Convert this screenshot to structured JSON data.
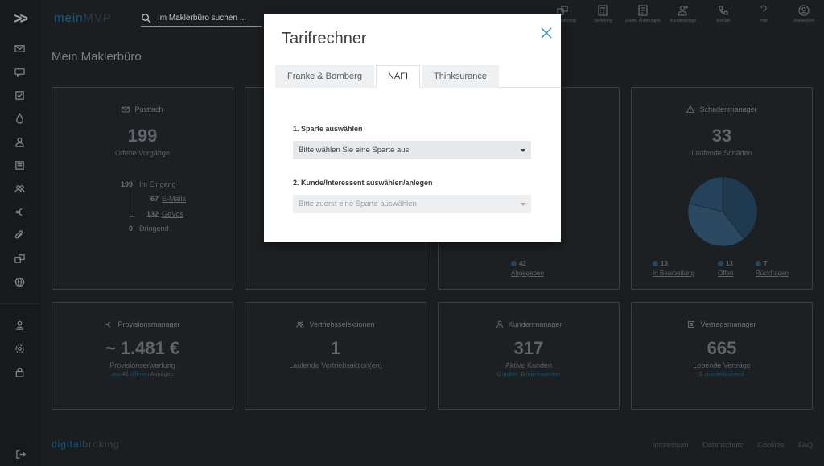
{
  "topbar": {
    "logo_a": "mein",
    "logo_b": "MVP",
    "search_label": "Im Maklerbüro suchen ...",
    "actions": [
      {
        "label": "Datenabholung",
        "icon": "download-icon"
      },
      {
        "label": "Tarifierung",
        "icon": "calculator-icon"
      },
      {
        "label": "autom. Änderungen",
        "icon": "changes-icon"
      },
      {
        "label": "Kundenanlage",
        "icon": "add-user-icon"
      },
      {
        "label": "Kontakt",
        "icon": "phone-icon"
      },
      {
        "label": "Hilfe",
        "icon": "help-icon"
      },
      {
        "label": "Maklerprofil",
        "icon": "profile-icon"
      }
    ]
  },
  "page_title": "Mein Maklerbüro",
  "cards": {
    "postfach": {
      "title": "Postfach",
      "big": "199",
      "sub": "Offene Vorgänge",
      "rows": [
        {
          "num": "199",
          "label": "Im Eingang"
        },
        {
          "num": "67",
          "label": "E-Mails"
        },
        {
          "num": "132",
          "label": "GeVos"
        },
        {
          "num": "0",
          "label": "Dringend"
        }
      ]
    },
    "bottom_fragment": {
      "num": "42",
      "label": "Abgegeben"
    },
    "schaden": {
      "title": "Schadenmanager",
      "big": "33",
      "sub": "Laufende Schäden",
      "legend": [
        {
          "num": "13",
          "label": "In Bearbeitung"
        },
        {
          "num": "13",
          "label": "Offen"
        },
        {
          "num": "7",
          "label": "Rückfragen"
        }
      ]
    },
    "provision": {
      "title": "Provisionsmanager",
      "big": "~ 1.481 €",
      "sub": "Provisionserwartung",
      "sub2_a": "aus",
      "sub2_b": "41",
      "sub2_c": "offenen",
      "sub2_d": "Anträgen"
    },
    "vertrieb": {
      "title": "Vertriebsselektionen",
      "big": "1",
      "sub": "Laufende Vertriebsaktion(en)"
    },
    "kunden": {
      "title": "Kundenmanager",
      "big": "317",
      "sub": "Aktive Kunden",
      "sub2_a": "0",
      "sub2_b": "inaktiv",
      "sub2_c": "0",
      "sub2_d": "Interessenten"
    },
    "vertrag": {
      "title": "Vertragsmanager",
      "big": "665",
      "sub": "Lebende Verträge",
      "sub2_a": "0",
      "sub2_b": "storniert/ruhend"
    }
  },
  "footer": {
    "logo_a": "digital",
    "logo_b": "broking",
    "links": [
      "Impressum",
      "Datenschutz",
      "Cookies",
      "FAQ"
    ]
  },
  "modal": {
    "title": "Tarifrechner",
    "tabs": [
      "Franke & Bornberg",
      "NAFI",
      "Thinksurance"
    ],
    "active_tab": "NAFI",
    "step1_label": "1. Sparte auswählen",
    "step1_value": "Bitte wählen Sie eine Sparte aus",
    "step2_label": "2. Kunde/Interessent auswählen/anlegen",
    "step2_value": "Bitte zuerst eine Sparte auswählen"
  },
  "colors": {
    "accent": "#2b8fd3",
    "brand": "#0f5d86",
    "pie_dark": "#1f3a4e",
    "pie_light": "#2b4a61"
  }
}
